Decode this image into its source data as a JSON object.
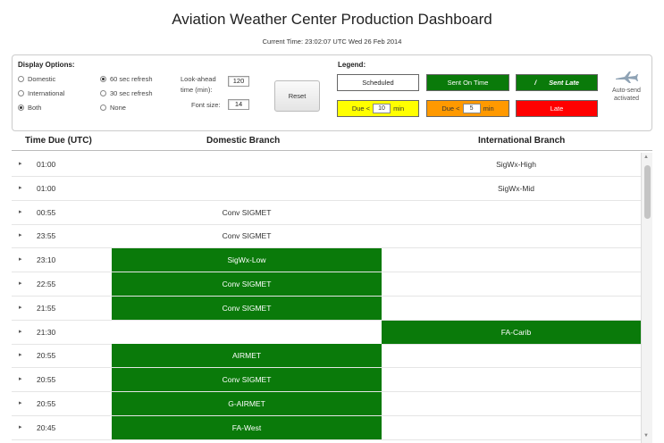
{
  "header": {
    "title": "Aviation Weather Center Production Dashboard",
    "current_time": "Current Time: 23:02:07 UTC Wed 26 Feb 2014"
  },
  "options": {
    "heading": "Display Options:",
    "scope": [
      {
        "label": "Domestic",
        "checked": false
      },
      {
        "label": "International",
        "checked": false
      },
      {
        "label": "Both",
        "checked": true
      }
    ],
    "refresh": [
      {
        "label": "60 sec refresh",
        "checked": true
      },
      {
        "label": "30 sec refresh",
        "checked": false
      },
      {
        "label": "None",
        "checked": false
      }
    ],
    "lookahead_label_1": "Look-ahead",
    "lookahead_label_2": "time (min):",
    "lookahead_value": "120",
    "font_size_label": "Font size:",
    "font_size_value": "14",
    "reset_label": "Reset"
  },
  "legend": {
    "heading": "Legend:",
    "scheduled": "Scheduled",
    "sent_on_time": "Sent On Time",
    "sent_late_marker": "/",
    "sent_late": "Sent Late",
    "due_prefix": "Due <",
    "due_yellow_value": "10",
    "due_orange_value": "5",
    "due_suffix": "min",
    "late": "Late",
    "auto_send_line1": "Auto-send",
    "auto_send_line2": "activated"
  },
  "table": {
    "col_time": "Time Due (UTC)",
    "col_domestic": "Domestic Branch",
    "col_international": "International Branch",
    "rows": [
      {
        "time": "01:00",
        "domestic": "",
        "international": "SigWx-High",
        "dom_status": "scheduled",
        "intl_status": "scheduled"
      },
      {
        "time": "01:00",
        "domestic": "",
        "international": "SigWx-Mid",
        "dom_status": "scheduled",
        "intl_status": "scheduled"
      },
      {
        "time": "00:55",
        "domestic": "Conv SIGMET",
        "international": "",
        "dom_status": "scheduled",
        "intl_status": "scheduled"
      },
      {
        "time": "23:55",
        "domestic": "Conv SIGMET",
        "international": "",
        "dom_status": "scheduled",
        "intl_status": "scheduled"
      },
      {
        "time": "23:10",
        "domestic": "SigWx-Low",
        "international": "",
        "dom_status": "sent",
        "intl_status": "scheduled"
      },
      {
        "time": "22:55",
        "domestic": "Conv SIGMET",
        "international": "",
        "dom_status": "sent",
        "intl_status": "scheduled"
      },
      {
        "time": "21:55",
        "domestic": "Conv SIGMET",
        "international": "",
        "dom_status": "sent",
        "intl_status": "scheduled"
      },
      {
        "time": "21:30",
        "domestic": "",
        "international": "FA-Carib",
        "dom_status": "scheduled",
        "intl_status": "sent"
      },
      {
        "time": "20:55",
        "domestic": "AIRMET",
        "international": "",
        "dom_status": "sent",
        "intl_status": "scheduled"
      },
      {
        "time": "20:55",
        "domestic": "Conv SIGMET",
        "international": "",
        "dom_status": "sent",
        "intl_status": "scheduled"
      },
      {
        "time": "20:55",
        "domestic": "G-AIRMET",
        "international": "",
        "dom_status": "sent",
        "intl_status": "scheduled"
      },
      {
        "time": "20:45",
        "domestic": "FA-West",
        "international": "",
        "dom_status": "sent",
        "intl_status": "scheduled"
      }
    ]
  },
  "colors": {
    "sent_green": "#0a7a0a",
    "due_yellow": "#ffff00",
    "due_orange": "#ff9900",
    "late_red": "#ff0000"
  }
}
